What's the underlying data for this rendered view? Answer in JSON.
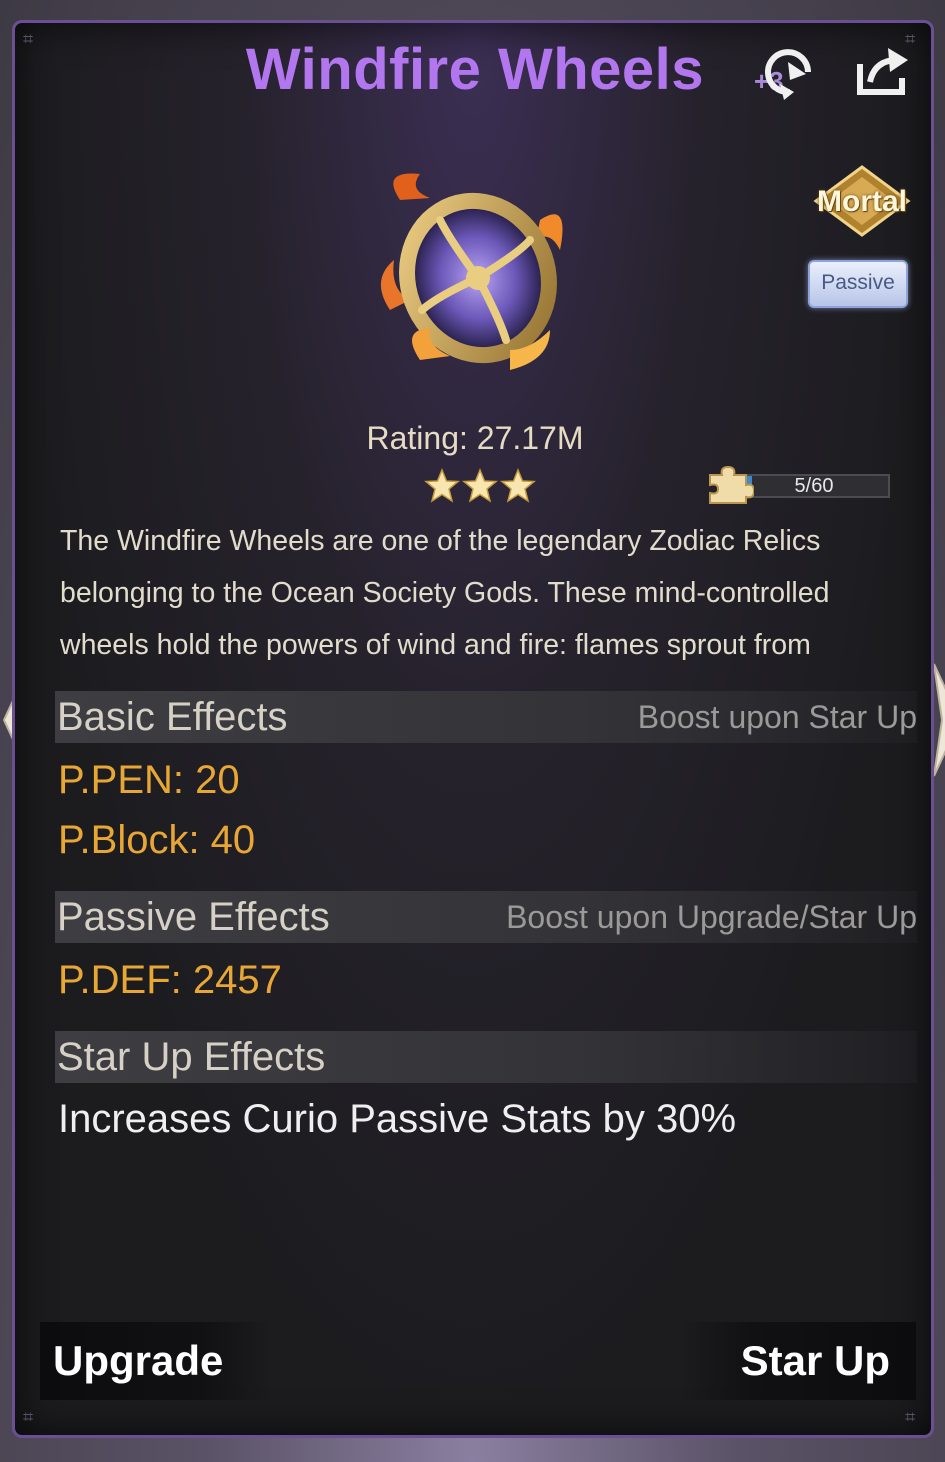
{
  "header": {
    "title": "Windfire Wheels",
    "reroll_badge": "+3",
    "reroll_icon": "reroll-icon",
    "share_icon": "share-icon"
  },
  "item": {
    "grade": "Mortal",
    "type_tag": "Passive",
    "rating": "Rating: 27.17M",
    "stars": 3,
    "shards": {
      "text": "5/60",
      "current": 5,
      "max": 60
    },
    "description_lines": [
      "The Windfire Wheels are one of the legendary Zodiac Relics",
      "belonging to the Ocean Society Gods. These mind-controlled",
      "wheels hold the powers of wind and fire: flames sprout from"
    ]
  },
  "basic_effects": {
    "title": "Basic Effects",
    "note": "Boost upon Star Up",
    "stats": [
      "P.PEN: 20",
      "P.Block: 40"
    ]
  },
  "passive_effects": {
    "title": "Passive Effects",
    "note": "Boost upon Upgrade/Star Up",
    "stats": [
      "P.DEF: 2457"
    ]
  },
  "star_up_effects": {
    "title": "Star Up Effects",
    "text": "Increases Curio Passive Stats by 30%"
  },
  "actions": {
    "upgrade_label": "Upgrade",
    "star_up_label": "Star Up"
  },
  "colors": {
    "title": "#b277ee",
    "stat": "#e8a735",
    "panel_border": "#6a4f92",
    "progress_fill": "#3d89c9"
  }
}
